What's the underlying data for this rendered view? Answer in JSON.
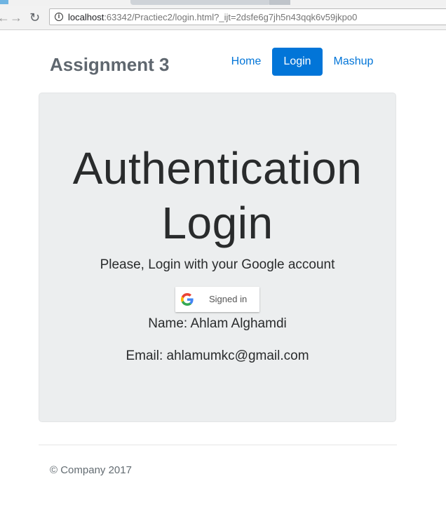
{
  "browser": {
    "url_host": "localhost",
    "url_rest": ":63342/Practiec2/login.html?_ijt=2dsfe6g7jh5n43qqk6v59jkpo0",
    "back_glyph": "←",
    "forward_glyph": "→",
    "reload_glyph": "↻",
    "info_glyph": "i"
  },
  "header": {
    "brand": "Assignment 3",
    "nav": {
      "home": "Home",
      "login": "Login",
      "mashup": "Mashup"
    },
    "active_nav": "Login",
    "accent_color": "#0275d8"
  },
  "main": {
    "title_line1": "Authentication",
    "title_line2": "Login",
    "lead": "Please, Login with your Google account",
    "google_button_label": "Signed in",
    "google_icon": "google-g-icon",
    "name_line": "Name: Ahlam Alghamdi",
    "email_line": "Email: ahlamumkc@gmail.com"
  },
  "footer": {
    "copyright": "© Company 2017"
  }
}
